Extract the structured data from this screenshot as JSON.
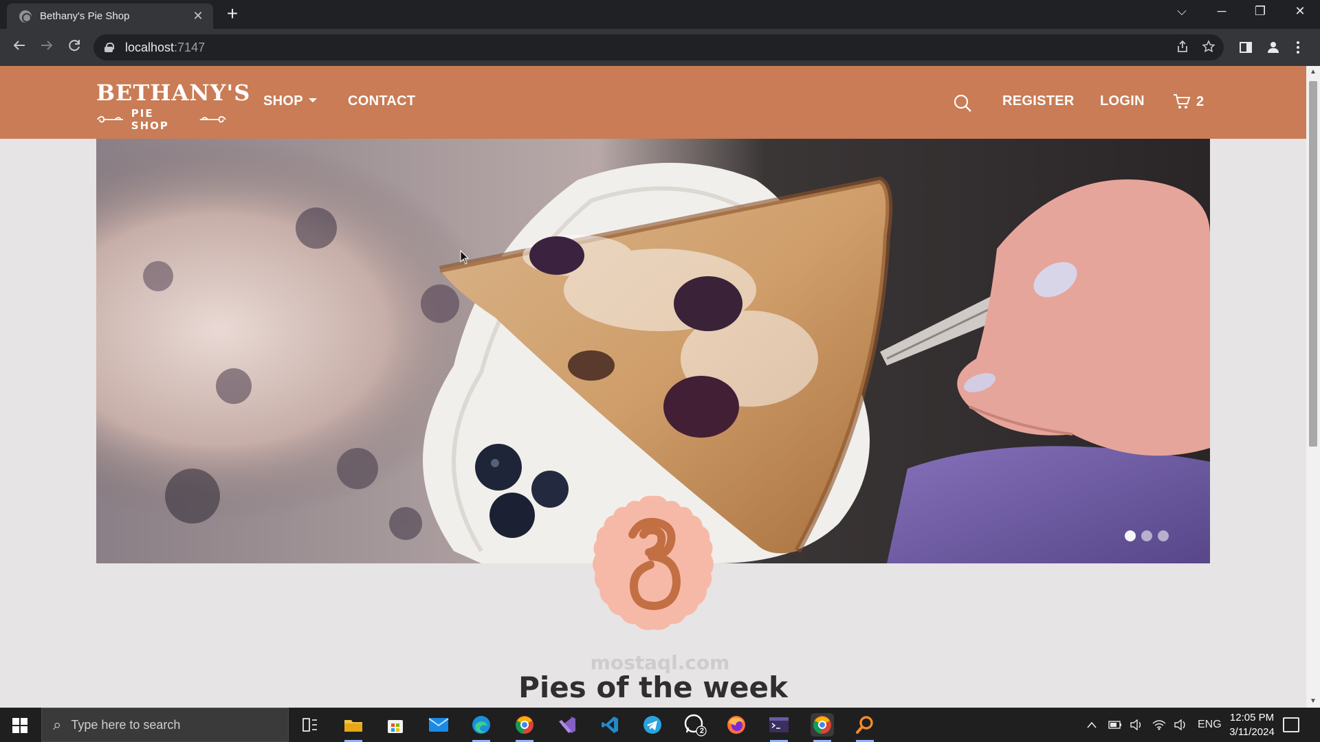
{
  "browser": {
    "tab_title": "Bethany's Pie Shop",
    "tab_close": "✕",
    "new_tab": "+",
    "url_host": "localhost",
    "url_port": ":7147",
    "controls": {
      "minimize": "─",
      "restore": "❐",
      "close": "✕",
      "tab_search": "⌵"
    }
  },
  "site": {
    "logo_main": "BETHANY'S",
    "logo_sub": "PIE SHOP",
    "nav": {
      "shop": "SHOP",
      "contact": "CONTACT",
      "register": "REGISTER",
      "login": "LOGIN",
      "cart_count": "2"
    },
    "carousel": {
      "slide_count": 3,
      "active_slide": 1
    },
    "section_title": "Pies of the week",
    "watermark": "mostaql.com",
    "colors": {
      "header": "#c97c55",
      "badge": "#f7b9a7",
      "badge_mark": "#c26f44"
    }
  },
  "taskbar": {
    "search_placeholder": "Type here to search",
    "language": "ENG",
    "time": "12:05 PM",
    "date": "3/11/2024",
    "apps": [
      "task-view",
      "file-explorer",
      "microsoft-store",
      "mail",
      "edge",
      "chrome-profile",
      "visual-studio",
      "vs-code",
      "telegram",
      "whatsapp",
      "firefox",
      "terminal",
      "chrome",
      "search-app"
    ],
    "whatsapp_badge": "2"
  }
}
